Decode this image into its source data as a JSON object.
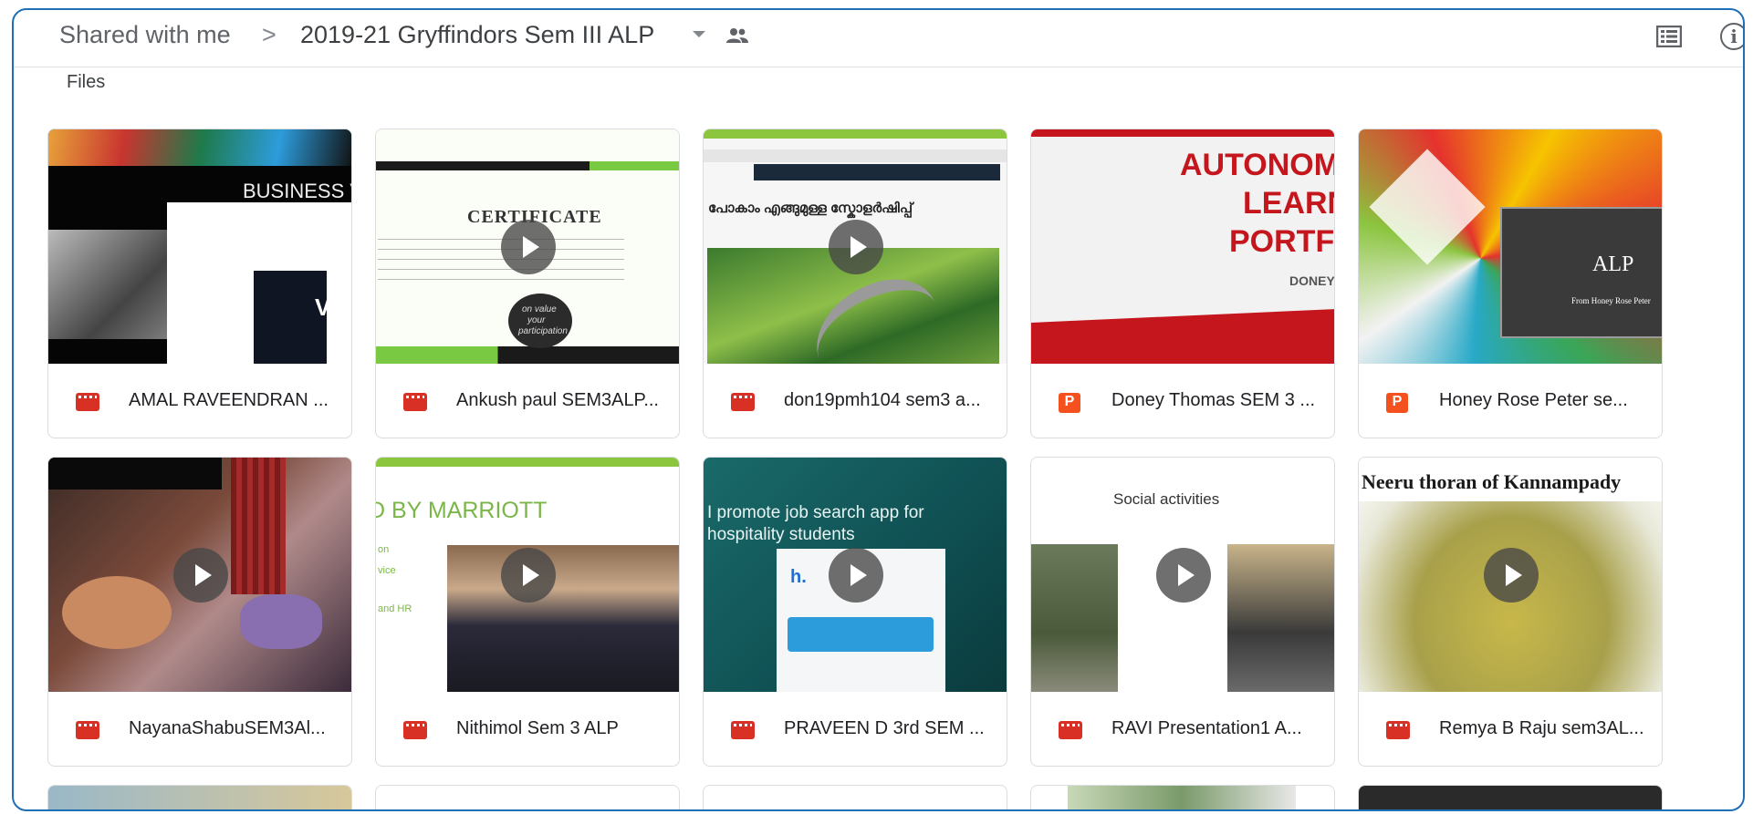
{
  "breadcrumb": {
    "root": "Shared with me",
    "separator": ">",
    "current": "2019-21 Gryffindors Sem III ALP"
  },
  "icons": {
    "dropdown": "caret-down-icon",
    "shared": "people-icon",
    "view_toggle": "list-view-icon",
    "info": "info-icon"
  },
  "info_glyph": "i",
  "section_label": "Files",
  "accent_colors": {
    "frame_border": "#1f6fb7",
    "video_icon": "#d93025",
    "slides_icon": "#f4511e"
  },
  "files": [
    {
      "name": "AMAL RAVEENDRAN ...",
      "type": "video",
      "thumb_text": [
        "BUSINESS V",
        "VE"
      ]
    },
    {
      "name": "Ankush paul SEM3ALP...",
      "type": "video",
      "thumb_text": [
        "CERTIFICATE",
        "on value",
        "your",
        "participation"
      ]
    },
    {
      "name": "don19pmh104 sem3 a...",
      "type": "video",
      "thumb_text": [
        "പോകാം എങ്ങുമുള്ള സ്കോളർഷിപ്പ്"
      ]
    },
    {
      "name": "Doney Thomas SEM 3 ...",
      "type": "slides",
      "type_glyph": "P",
      "thumb_text": [
        "AUTONOMO",
        "LEARNI",
        "PORTFO",
        "DONEY T"
      ]
    },
    {
      "name": "Honey Rose Peter se...",
      "type": "slides",
      "type_glyph": "P",
      "thumb_text": [
        "ALP",
        "From Honey Rose Peter"
      ]
    },
    {
      "name": "NayanaShabuSEM3Al...",
      "type": "video",
      "thumb_text": []
    },
    {
      "name": "Nithimol Sem 3 ALP",
      "type": "video",
      "thumb_text": [
        "D BY MARRIOTT",
        "on",
        "vice",
        "and HR"
      ]
    },
    {
      "name": "PRAVEEN D 3rd SEM ...",
      "type": "video",
      "thumb_text": [
        "I promote job search app for",
        "hospitality students",
        "h."
      ]
    },
    {
      "name": "RAVI Presentation1 A...",
      "type": "video",
      "thumb_text": [
        "Social activities"
      ]
    },
    {
      "name": "Remya B Raju sem3AL...",
      "type": "video",
      "thumb_text": [
        "Neeru thoran of Kannampady"
      ]
    }
  ]
}
